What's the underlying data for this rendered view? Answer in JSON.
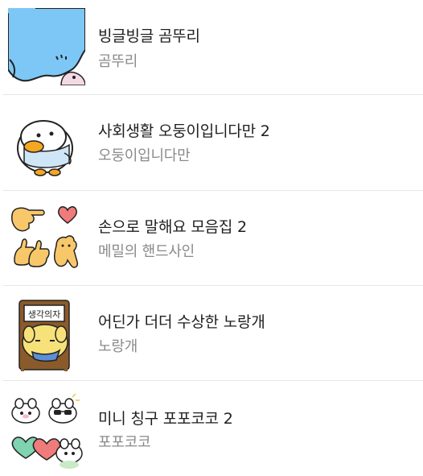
{
  "sticker_list": {
    "items": [
      {
        "title": "빙글빙글 곰뚜리",
        "creator": "곰뚜리",
        "icon": "blue-bear-sticker-icon"
      },
      {
        "title": "사회생활 오둥이입니다만 2",
        "creator": "오둥이입니다만",
        "icon": "white-duck-sticker-icon"
      },
      {
        "title": "손으로 말해요 모음집 2",
        "creator": "메밀의 핸드사인",
        "icon": "hand-signs-sticker-icon"
      },
      {
        "title": "어딘가 더더 수상한 노랑개",
        "creator": "노랑개",
        "icon": "yellow-dog-sticker-icon"
      },
      {
        "title": "미니 칭구 포포코코 2",
        "creator": "포포코코",
        "icon": "mini-friends-sticker-icon"
      }
    ],
    "sign_text": "생각의자"
  }
}
